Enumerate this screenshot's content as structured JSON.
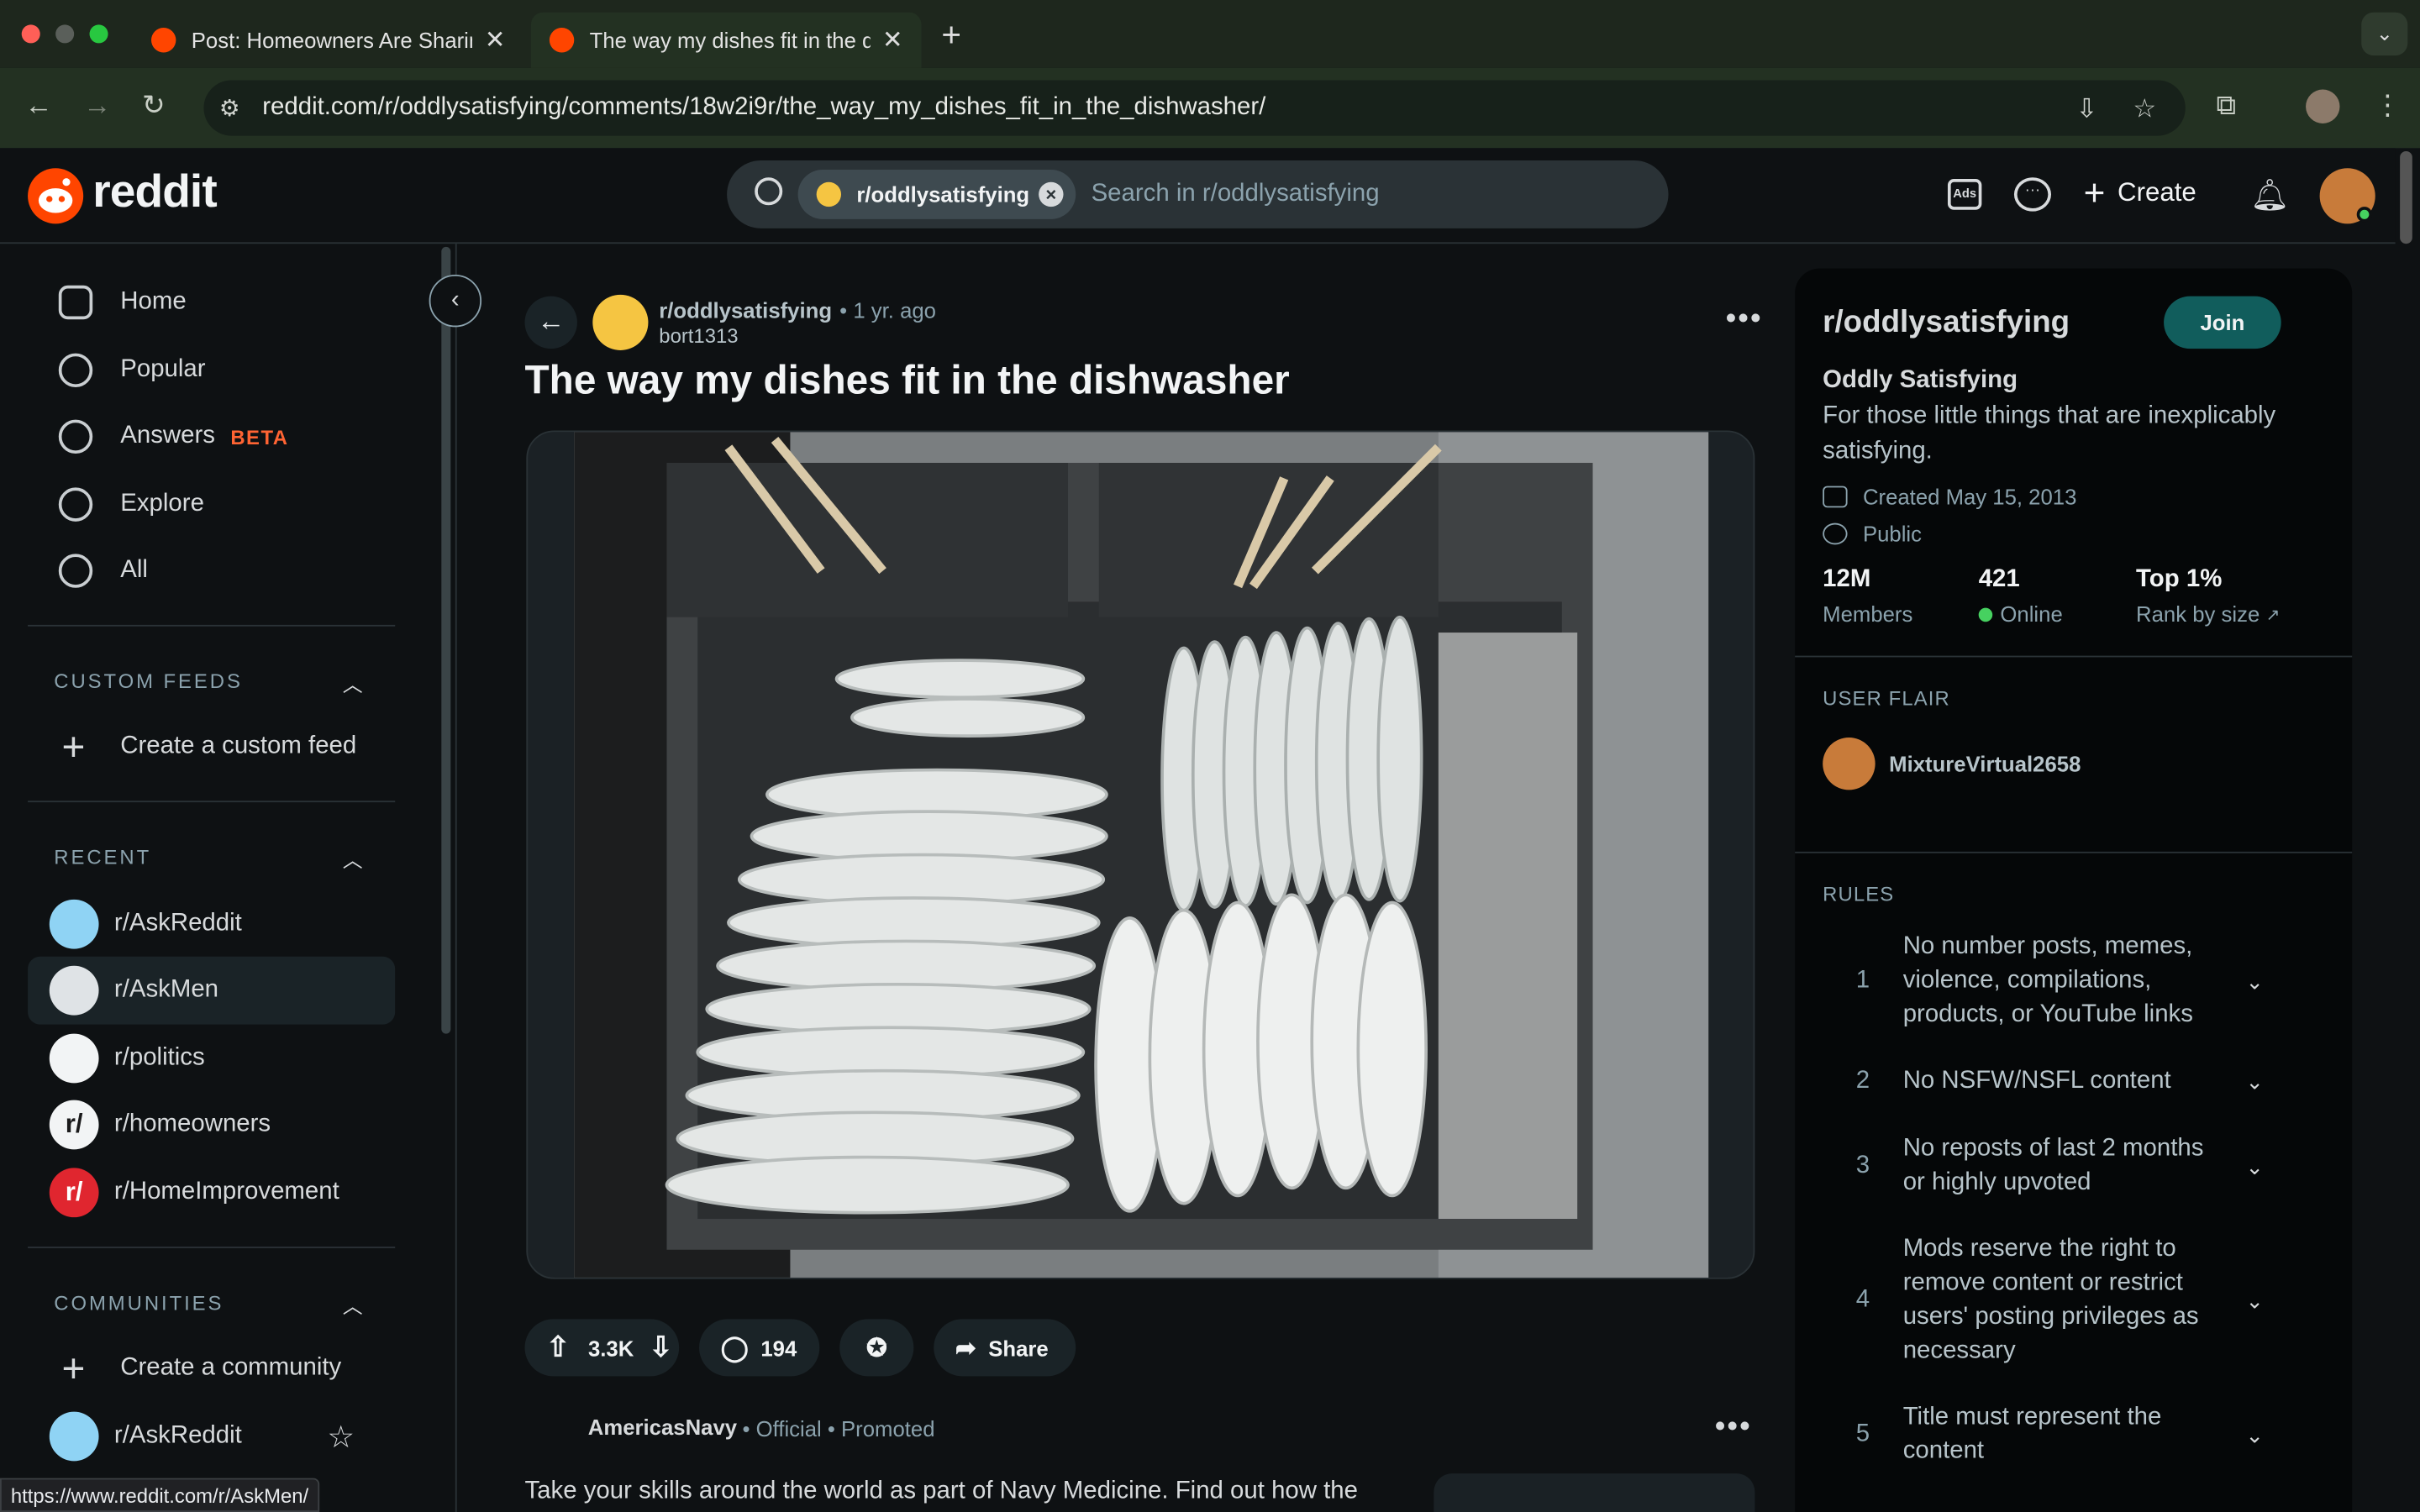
{
  "browser": {
    "tabs": [
      {
        "label": "Post: Homeowners Are Sharing",
        "close": "✕"
      },
      {
        "label": "The way my dishes fit in the dishwasher",
        "close": "✕"
      }
    ],
    "new_tab": "+",
    "url": "reddit.com/r/oddlysatisfying/comments/18w2i9r/the_way_my_dishes_fit_in_the_dishwasher/",
    "status_url": "https://www.reddit.com/r/AskMen/"
  },
  "header": {
    "logo": "reddit",
    "search_chip": "r/oddlysatisfying",
    "search_placeholder": "Search in r/oddlysatisfying",
    "create_label": "Create",
    "ads_label": "Ads"
  },
  "left_nav": {
    "items": [
      {
        "label": "Home",
        "icon": "home-icon"
      },
      {
        "label": "Popular",
        "icon": "popular-icon"
      },
      {
        "label": "Answers",
        "icon": "answers-icon",
        "badge": "BETA"
      },
      {
        "label": "Explore",
        "icon": "explore-icon"
      },
      {
        "label": "All",
        "icon": "all-icon"
      }
    ],
    "custom_feeds": {
      "title": "CUSTOM FEEDS",
      "create": "Create a custom feed"
    },
    "recent": {
      "title": "RECENT",
      "items": [
        {
          "label": "r/AskReddit",
          "color": "#8fd3f4"
        },
        {
          "label": "r/AskMen",
          "color": "#dfe3e6"
        },
        {
          "label": "r/politics",
          "color": "#f2f4f5"
        },
        {
          "label": "r/homeowners",
          "color": "#f2f4f5"
        },
        {
          "label": "r/HomeImprovement",
          "color": "#e0262f"
        }
      ]
    },
    "communities": {
      "title": "COMMUNITIES",
      "create": "Create a community",
      "items": [
        {
          "label": "r/AskReddit"
        }
      ]
    }
  },
  "post": {
    "subreddit": "r/oddlysatisfying",
    "age": "• 1 yr. ago",
    "author": "bort1313",
    "title": "The way my dishes fit in the dishwasher",
    "upvotes": "3.3K",
    "comments": "194",
    "share": "Share"
  },
  "promoted": {
    "user": "AmericasNavy",
    "meta": "• Official  •  Promoted",
    "text": "Take your skills around the world as part of Navy Medicine. Find out how the"
  },
  "sidebar": {
    "title": "r/oddlysatisfying",
    "join": "Join",
    "name": "Oddly Satisfying",
    "description": "For those little things that are inexplicably satisfying.",
    "created": "Created May 15, 2013",
    "visibility": "Public",
    "stats": [
      {
        "value": "12M",
        "label": "Members"
      },
      {
        "value": "421",
        "label": "Online"
      },
      {
        "value": "Top 1%",
        "label": "Rank by size"
      }
    ],
    "user_flair_title": "USER FLAIR",
    "flair_user": "MixtureVirtual2658",
    "rules_title": "RULES",
    "rules": [
      "No number posts, memes, violence, compilations, products, or YouTube links",
      "No NSFW/NSFL content",
      "No reposts of last 2 months or highly upvoted",
      "Mods reserve the right to remove content or restrict users' posting privileges as necessary",
      "Title must represent the content"
    ]
  }
}
